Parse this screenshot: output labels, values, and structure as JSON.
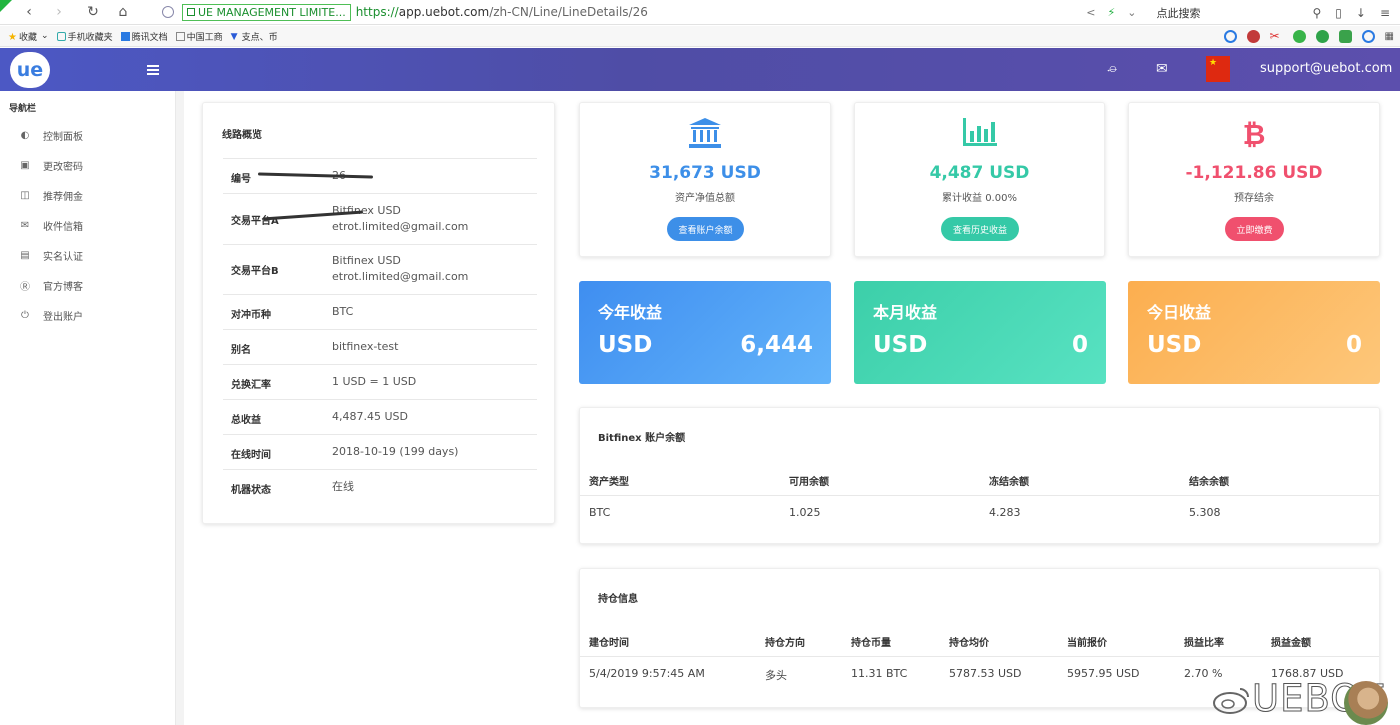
{
  "browser": {
    "site_badge": "UE MANAGEMENT LIMITE...",
    "url_scheme": "https://",
    "url_host": "app.uebot.com",
    "url_path": "/zh-CN/Line/LineDetails/26",
    "search_placeholder": "点此搜索",
    "bookmarks": [
      "收藏",
      "手机收藏夹",
      "腾讯文档",
      "中国工商",
      "支点、币"
    ]
  },
  "header": {
    "logo_text": "ue",
    "support_email": "support@uebot.com"
  },
  "sidebar": {
    "title": "导航栏",
    "items": [
      {
        "label": "控制面板",
        "icon": "dashboard-icon"
      },
      {
        "label": "更改密码",
        "icon": "lock-icon"
      },
      {
        "label": "推荐佣金",
        "icon": "gift-icon"
      },
      {
        "label": "收件信箱",
        "icon": "mail-icon"
      },
      {
        "label": "实名认证",
        "icon": "id-card-icon"
      },
      {
        "label": "官方博客",
        "icon": "wordpress-icon"
      },
      {
        "label": "登出账户",
        "icon": "power-icon"
      }
    ]
  },
  "overview": {
    "title": "线路概览",
    "rows": [
      {
        "label": "编号",
        "value": "26"
      },
      {
        "label": "交易平台A",
        "value": "Bitfinex USD",
        "value2": "etrot.limited@gmail.com"
      },
      {
        "label": "交易平台B",
        "value": "Bitfinex USD",
        "value2": "etrot.limited@gmail.com"
      },
      {
        "label": "对冲币种",
        "value": "BTC"
      },
      {
        "label": "别名",
        "value": "bitfinex-test"
      },
      {
        "label": "兑换汇率",
        "value": "1 USD = 1 USD"
      },
      {
        "label": "总收益",
        "value": "4,487.45 USD"
      },
      {
        "label": "在线时间",
        "value": "2018-10-19 (199 days)"
      },
      {
        "label": "机器状态",
        "value": "在线"
      }
    ]
  },
  "stats": [
    {
      "value": "31,673 USD",
      "label": "资产净值总额",
      "button": "查看账户余额",
      "color": "#3d8fe8",
      "icon": "bank-icon"
    },
    {
      "value": "4,487 USD",
      "label": "累计收益 0.00%",
      "button": "查看历史收益",
      "color": "#35c9a7",
      "icon": "bar-chart-icon"
    },
    {
      "value": "-1,121.86 USD",
      "label": "预存结余",
      "button": "立即缴费",
      "color": "#f0506e",
      "icon": "bitcoin-icon"
    }
  ],
  "earnings": [
    {
      "title": "今年收益",
      "currency": "USD",
      "value": "6,444"
    },
    {
      "title": "本月收益",
      "currency": "USD",
      "value": "0"
    },
    {
      "title": "今日收益",
      "currency": "USD",
      "value": "0"
    }
  ],
  "balance": {
    "title": "Bitfinex 账户余额",
    "headers": [
      "资产类型",
      "可用余额",
      "冻结余额",
      "结余余额"
    ],
    "rows": [
      [
        "BTC",
        "1.025",
        "4.283",
        "5.308"
      ]
    ]
  },
  "positions": {
    "title": "持仓信息",
    "headers": [
      "建仓时间",
      "持仓方向",
      "持仓币量",
      "持仓均价",
      "当前报价",
      "损益比率",
      "损益金额"
    ],
    "rows": [
      [
        "5/4/2019 9:57:45 AM",
        "多头",
        "11.31 BTC",
        "5787.53 USD",
        "5957.95 USD",
        "2.70 %",
        "1768.87 USD"
      ]
    ]
  },
  "watermark": {
    "text": "UEBOT"
  }
}
